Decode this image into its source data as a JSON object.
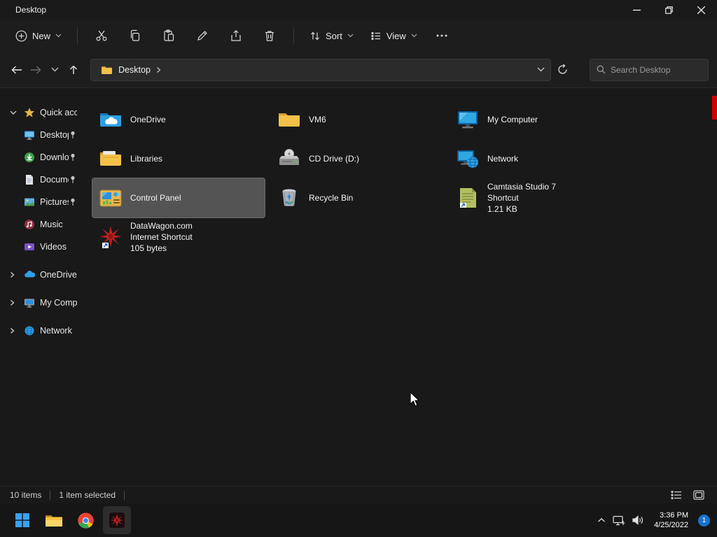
{
  "window": {
    "title": "Desktop"
  },
  "toolbar": {
    "new_label": "New",
    "sort_label": "Sort",
    "view_label": "View"
  },
  "address": {
    "location": "Desktop",
    "search_placeholder": "Search Desktop"
  },
  "sidebar": {
    "items": [
      {
        "label": "Quick access",
        "pinned": false
      },
      {
        "label": "Desktop",
        "pinned": true
      },
      {
        "label": "Downloads",
        "pinned": true
      },
      {
        "label": "Documents",
        "pinned": true
      },
      {
        "label": "Pictures",
        "pinned": true
      },
      {
        "label": "Music",
        "pinned": false
      },
      {
        "label": "Videos",
        "pinned": false
      },
      {
        "label": "OneDrive",
        "pinned": false
      },
      {
        "label": "My Computer",
        "pinned": false
      },
      {
        "label": "Network",
        "pinned": false
      }
    ]
  },
  "content": {
    "items": [
      {
        "name": "OneDrive"
      },
      {
        "name": "VM6"
      },
      {
        "name": "My Computer"
      },
      {
        "name": "Libraries"
      },
      {
        "name": "CD Drive (D:)"
      },
      {
        "name": "Network"
      },
      {
        "name": "Control Panel",
        "selected": true
      },
      {
        "name": "Recycle Bin"
      },
      {
        "name": "Camtasia Studio 7",
        "line2": "Shortcut",
        "line3": "1.21 KB"
      },
      {
        "name": "DataWagon.com",
        "line2": "Internet Shortcut",
        "line3": "105 bytes"
      }
    ]
  },
  "statusbar": {
    "item_count": "10 items",
    "selection": "1 item selected"
  },
  "taskbar": {
    "time": "3:36 PM",
    "date": "4/25/2022",
    "notification_badge": "1"
  },
  "colors": {
    "selection": "#545454",
    "accent": "#2fa0e0",
    "folder_yellow": "#f3c04a",
    "record_strip": "#d40000",
    "badge": "#1773cf"
  }
}
